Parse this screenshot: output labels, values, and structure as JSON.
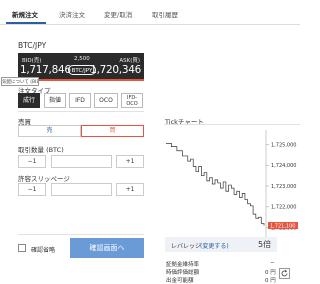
{
  "tabs": [
    {
      "label": "新規注文",
      "active": true
    },
    {
      "label": "決済注文",
      "active": false
    },
    {
      "label": "変更/取消",
      "active": false
    },
    {
      "label": "取引履歴",
      "active": false
    }
  ],
  "pair": "BTC/JPY",
  "quote": {
    "bid_label": "BID(売)",
    "spread": "2,500",
    "ask_label": "ASK(買)",
    "bid": "1,717,846",
    "ask": "1,720,346",
    "currency_pill": "BTC/JPY"
  },
  "tooltip": "気配について (BID/ASK)",
  "order_type": {
    "label": "注文タイプ",
    "options": [
      {
        "label": "成行",
        "active": true
      },
      {
        "label": "指値",
        "active": false
      },
      {
        "label": "IFD",
        "active": false
      },
      {
        "label": "OCO",
        "active": false
      },
      {
        "label": "IFD-OCO",
        "active": false
      }
    ]
  },
  "side": {
    "label": "売買",
    "buy": "売",
    "sell": "買"
  },
  "quantity": {
    "label": "取引数量 (BTC)",
    "minus": "−1",
    "plus": "+1"
  },
  "slippage": {
    "label": "許容スリッページ",
    "minus": "−1",
    "plus": "+1"
  },
  "chart_data": {
    "type": "line",
    "title": "Tickチャート",
    "y_ticks": [
      "1,725,000",
      "1,724,000",
      "1,723,000",
      "1,722,000",
      "1,721,000"
    ],
    "ylim": [
      1720500,
      1725700
    ],
    "values": [
      1725050,
      1725050,
      1724900,
      1724900,
      1724700,
      1724700,
      1724450,
      1724450,
      1724200,
      1724300,
      1723950,
      1723700,
      1723950,
      1723500,
      1723650,
      1723250,
      1723400,
      1723100,
      1723300,
      1723150,
      1722900,
      1723200,
      1722750,
      1723050,
      1722900,
      1722600,
      1722750,
      1722450,
      1722650,
      1722350,
      1722150,
      1722050,
      1721650,
      1721450,
      1721500,
      1721200,
      1721100
    ],
    "last_label": "1,721,100",
    "line_color": "#333333",
    "last_color": "#e8553e"
  },
  "confirm": {
    "checkbox_label": "確認省略",
    "button_label": "確認画面へ"
  },
  "leverage": {
    "label": "レバレッジ",
    "change": "(変更する)",
    "value": "5倍"
  },
  "margin": [
    {
      "label": "証拠金維持率",
      "value": "−"
    },
    {
      "label": "時価評価総額",
      "value": "0 円"
    },
    {
      "label": "出金可能額",
      "value": "0 円"
    }
  ]
}
